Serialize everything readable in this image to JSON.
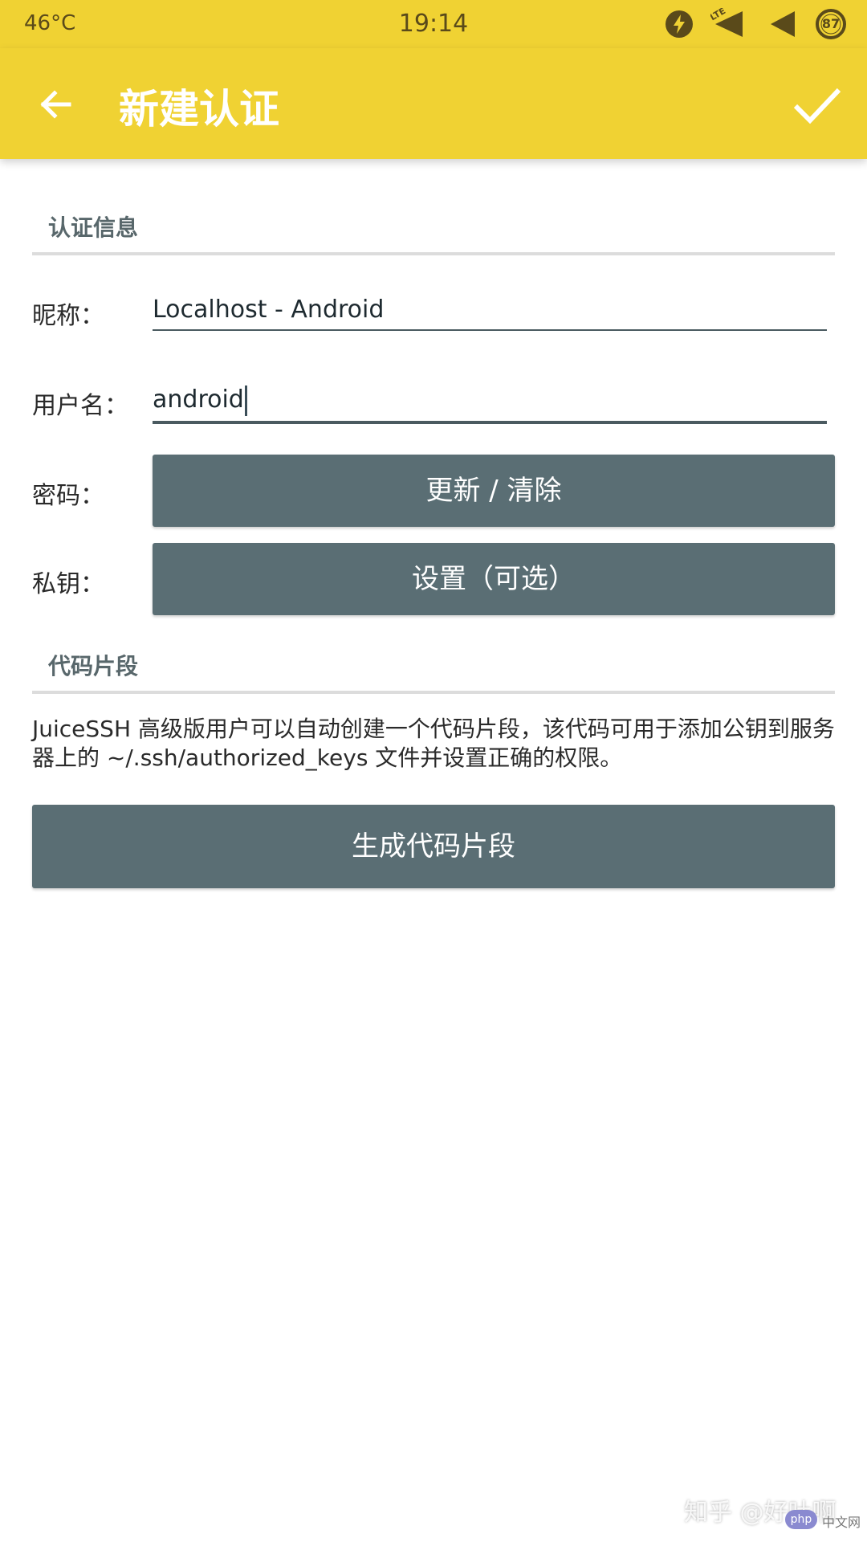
{
  "status_bar": {
    "temperature": "46°C",
    "time": "19:14",
    "network": "LTE",
    "battery": "87",
    "icons": [
      "power-saver-icon",
      "lte-signal-icon",
      "signal-icon",
      "battery-icon"
    ]
  },
  "app_bar": {
    "title": "新建认证",
    "back_icon": "arrow-left-icon",
    "confirm_icon": "check-icon",
    "color": "#f0d233"
  },
  "auth_section": {
    "title": "认证信息",
    "nickname_label": "昵称：",
    "nickname_value": "Localhost - Android",
    "username_label": "用户名：",
    "username_value": "android",
    "password_label": "密码：",
    "password_button": "更新 / 清除",
    "private_key_label": "私钥：",
    "private_key_button": "设置（可选）"
  },
  "snippet_section": {
    "title": "代码片段",
    "description": "JuiceSSH 高级版用户可以自动创建一个代码片段，该代码可用于添加公钥到服务器上的 ~/.ssh/authorized_keys 文件并设置正确的权限。",
    "generate_button": "生成代码片段"
  },
  "watermark": {
    "text": "知乎 @好吐啊",
    "badge": "php",
    "badge_caption": "中文网"
  },
  "colors": {
    "accent": "#f0d233",
    "button": "#5a6e74",
    "section_text": "#58676b"
  }
}
